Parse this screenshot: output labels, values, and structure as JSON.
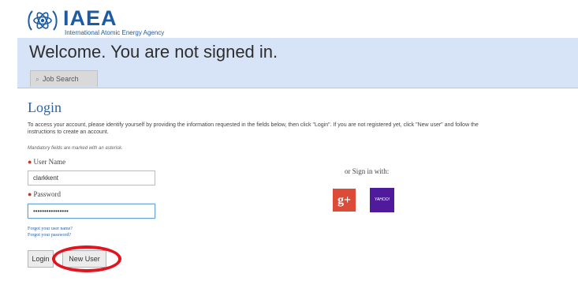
{
  "header": {
    "logo_name": "IAEA",
    "logo_subtitle": "International Atomic Energy Agency",
    "welcome": "Welcome. You are not signed in.",
    "job_search_tab": "Job Search"
  },
  "login": {
    "title": "Login",
    "instructions_line1": "To access your account, please identify yourself by providing the information requested in the fields below, then click \"Login\". If you are not registered yet, click \"New user\" and follow the",
    "instructions_line2": "instructions to create an account.",
    "mandatory_note": "Mandatory fields are marked with an asterisk.",
    "username_label": "User Name",
    "username_value": "clarkkent",
    "password_label": "Password",
    "password_value": "••••••••••••••••",
    "forgot_username": "Forgot your user name?",
    "forgot_password": "Forgot your password?",
    "login_button": "Login",
    "new_user_button": "New User"
  },
  "social": {
    "label": "or Sign in with:",
    "google_label": "g+",
    "yahoo_label": "YAHOO!",
    "google_color": "#dc4a38",
    "yahoo_color": "#4f1a9c"
  },
  "highlight_color": "#e0151f"
}
